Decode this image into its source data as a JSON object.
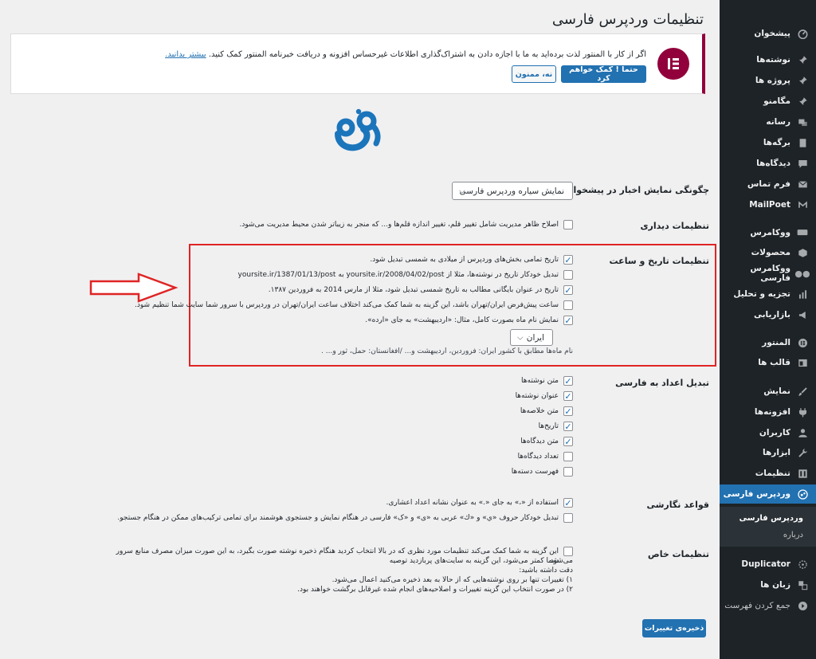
{
  "page": {
    "title": "تنظیمات وردپرس فارسی"
  },
  "sidebar": {
    "items": [
      {
        "label": "پیشخوان",
        "icon": "dashboard-icon"
      },
      {
        "label": "نوشته‌ها",
        "icon": "pin-icon"
      },
      {
        "label": "پروژه ها",
        "icon": "pin-icon"
      },
      {
        "label": "مگامنو",
        "icon": "pin-icon"
      },
      {
        "label": "رسانه",
        "icon": "media-icon"
      },
      {
        "label": "برگه‌ها",
        "icon": "pages-icon"
      },
      {
        "label": "دیدگاه‌ها",
        "icon": "comments-icon"
      },
      {
        "label": "فرم تماس",
        "icon": "mail-icon"
      },
      {
        "label": "MailPoet",
        "icon": "mailpoet-icon"
      },
      {
        "label": "ووکامرس",
        "icon": "woo-icon"
      },
      {
        "label": "محصولات",
        "icon": "box-icon"
      },
      {
        "label": "ووکامرس فارسی",
        "icon": "woo-fa-icon"
      },
      {
        "label": "تجزیه و تحلیل",
        "icon": "analytics-icon"
      },
      {
        "label": "بازاریابی",
        "icon": "megaphone-icon"
      },
      {
        "label": "المنتور",
        "icon": "elementor-icon"
      },
      {
        "label": "قالب ها",
        "icon": "template-icon"
      },
      {
        "label": "نمایش",
        "icon": "brush-icon"
      },
      {
        "label": "افزونه‌ها",
        "icon": "plugin-icon"
      },
      {
        "label": "کاربران",
        "icon": "user-icon"
      },
      {
        "label": "ابزارها",
        "icon": "wrench-icon"
      },
      {
        "label": "تنظیمات",
        "icon": "settings-icon"
      },
      {
        "label": "وردپرس فارسی",
        "icon": "wp-fa-icon"
      },
      {
        "label": "Duplicator",
        "icon": "duplicator-icon"
      },
      {
        "label": "زبان ها",
        "icon": "language-icon"
      },
      {
        "label": "جمع کردن فهرست",
        "icon": "collapse-icon"
      }
    ],
    "submenu": [
      "وردپرس فارسی",
      "درباره"
    ]
  },
  "notice": {
    "text": "اگر از کار با المنتور لذت برده‌اید به ما با اجازه دادن به اشتراک‌گذاری اطلاعات غیرحساس افزونه و دریافت خبرنامه المنتور کمک کنید.",
    "link": "بیشتر بدانید.",
    "primary_button": "حتما ! کمک خواهم کرد",
    "secondary_button": "نه، ممنون"
  },
  "dashboard_news": {
    "label": "چگونگی نمایش اخبار در پیشخوان",
    "selected": "نمایش سیاره وردپرس فارسی"
  },
  "visual": {
    "label": "تنظیمات دیداری",
    "option": "اصلاح ظاهر مدیریت شامل تغییر قلم، تغییر اندازه قلم‌ها و... که منجر به زیباتر شدن محیط مدیریت می‌شود."
  },
  "datetime": {
    "label": "تنظیمات تاریخ و ساعت",
    "options": [
      "تاریخ تمامی بخش‌های وردپرس از میلادی به شمسی تبدیل شود.",
      "تبدیل خودکار تاریخ در نوشته‌ها، مثلا از yoursite.ir/2008/04/02/post به yoursite.ir/1387/01/13/post",
      "تاریخ در عنوان بایگانی مطالب به تاریخ شمسی تبدیل شود، مثلا از مارس 2014 به فروردین ۱۳۸۷.",
      "ساعت پیش‌فرض ایران/تهران باشد، این گزینه به شما کمک می‌کند اختلاف ساعت ایران/تهران در وردپرس با سرور شما سایت شما تنظیم شود.",
      "نمایش نام ماه بصورت کامل، مثال: «اردیبهشت» به جای «ارده»."
    ],
    "country_select": "ایران",
    "help": "نام ماه‌ها مطابق با کشور ایران: فروردین، اردیبهشت و... /افغانستان: حمل، ثور و... ."
  },
  "numbers": {
    "label": "تبدیل اعداد به فارسی",
    "options": [
      "متن نوشته‌ها",
      "عنوان نوشته‌ها",
      "متن خلاصه‌ها",
      "تاریخ‌ها",
      "متن دیدگاه‌ها",
      "تعداد دیدگاه‌ها",
      "فهرست دسته‌ها"
    ]
  },
  "writing": {
    "label": "قواعد نگارشی",
    "options": [
      "استفاده از «،» به جای «.» به عنوان نشانه اعداد اعشاری.",
      "تبدیل خودکار حروف «ي» و «ك» عربی به «ی» و «ک» فارسی در هنگام نمایش و جستجوی هوشمند برای تمامی ترکیب‌های ممکن در هنگام جستجو."
    ]
  },
  "special": {
    "label": "تنظیمات خاص",
    "line1": "این گزینه به شما کمک می‌کند تنظیمات مورد نظری که در بالا انتخاب کردید هنگام ذخیره نوشته صورت بگیرد، به این صورت میزان مصرف منابع سرور شما کمتر می‌شود، این گزینه به سایت‌های پربازدید توصیه",
    "line2": "می‌شود.",
    "line3": "دقت داشته باشید:",
    "line4": "۱) تغییرات تنها بر روی نوشته‌هایی که از حالا به بعد ذخیره می‌کنید اعمال می‌شود.",
    "line5": "۲) در صورت انتخاب این گزینه تغییرات و اصلاحیه‌های انجام شده غیرقابل برگشت خواهند بود."
  },
  "save_button": "ذخیره‌ی تغییرات",
  "colors": {
    "sidebar": "#1d2327",
    "accent": "#2271b1",
    "elementor": "#92003b",
    "highlight": "#e02424"
  }
}
